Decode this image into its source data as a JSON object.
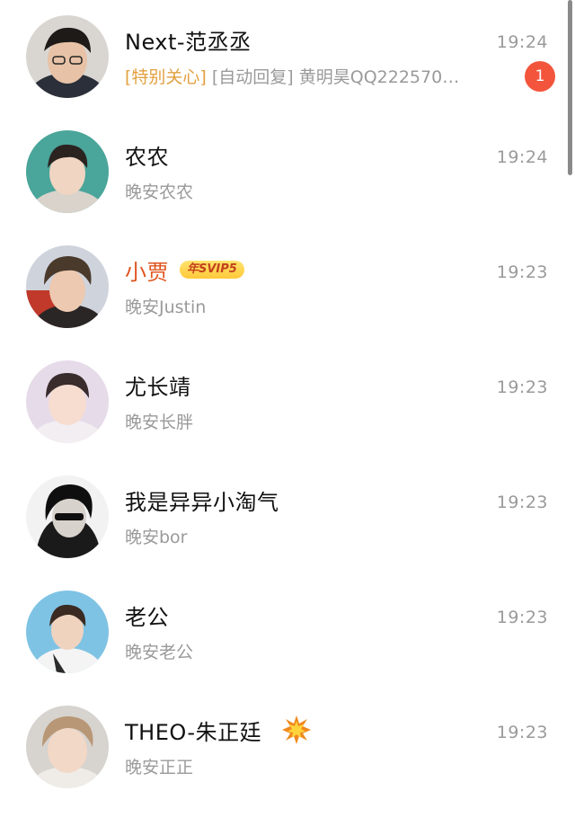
{
  "conversations": [
    {
      "name": "Next-范丞丞",
      "time": "19:24",
      "tag_special": "[特别关心]",
      "tag_auto": "[自动回复]",
      "preview": "黄明昊QQ222570…",
      "unread": "1"
    },
    {
      "name": "农农",
      "time": "19:24",
      "preview": "晚安农农"
    },
    {
      "name": "小贾",
      "badge": "年SVIP5",
      "time": "19:23",
      "preview": "晚安Justin"
    },
    {
      "name": "尤长靖",
      "time": "19:23",
      "preview": "晚安长胖"
    },
    {
      "name": "我是异异小淘气",
      "time": "19:23",
      "preview": "晚安bor"
    },
    {
      "name": "老公",
      "time": "19:23",
      "preview": "晚安老公"
    },
    {
      "name": "THEO-朱正廷",
      "badge_icon": "explosion-emoji-icon",
      "time": "19:23",
      "preview": "晚安正正"
    }
  ],
  "colors": {
    "vip_name": "#e0541f",
    "special_tag": "#e3a040",
    "unread_badge": "#f3553c",
    "secondary_text": "#9a9a9a"
  }
}
